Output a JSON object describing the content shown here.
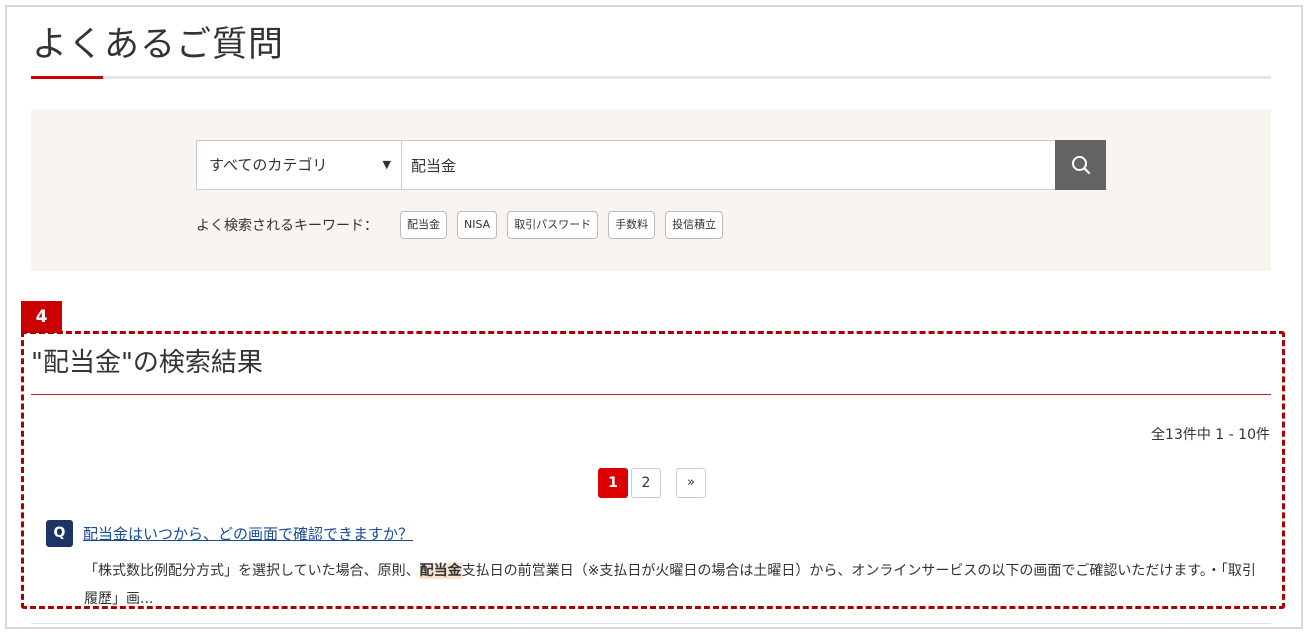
{
  "page": {
    "title": "よくあるご質問"
  },
  "search": {
    "category": "すべてのカテゴリ",
    "query": "配当金",
    "button_icon": "search-icon"
  },
  "keywords": {
    "label": "よく検索されるキーワード：",
    "items": [
      "配当金",
      "NISA",
      "取引パスワード",
      "手数料",
      "投信積立"
    ]
  },
  "annotation": {
    "badge": "4"
  },
  "results": {
    "title": "\"配当金\"の検索結果",
    "count": "全13件中 1 - 10件",
    "pagination": {
      "pages": [
        "1",
        "2"
      ],
      "current": "1",
      "next": "»"
    },
    "items": [
      {
        "q_badge": "Q",
        "question": "配当金はいつから、どの画面で確認できますか？",
        "answer_before": "「株式数比例配分方式」を選択していた場合、原則、",
        "answer_highlight": "配当金",
        "answer_after": "支払日の前営業日（※支払日が火曜日の場合は土曜日）から、オンラインサービスの以下の画面でご確認いただけます。・「取引履歴」画..."
      }
    ]
  },
  "colors": {
    "accent_red": "#cc0000",
    "panel_bg": "#f8f4f0",
    "search_button": "#636363",
    "q_badge": "#1d3466",
    "link": "#1a4b99",
    "highlight_bg": "#fbe3d0"
  }
}
